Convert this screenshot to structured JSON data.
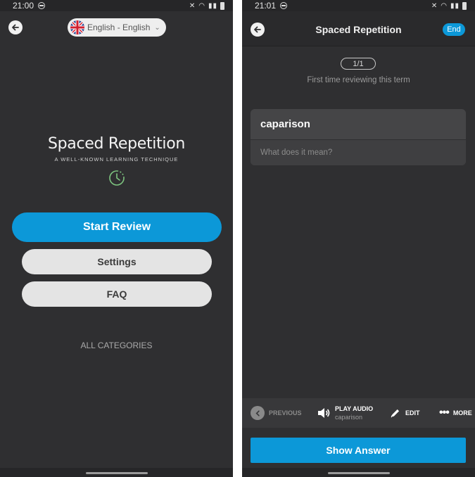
{
  "left_screen": {
    "status": {
      "time": "21:00"
    },
    "language_selector": {
      "label": "English - English"
    },
    "brand": {
      "title": "Spaced Repetition",
      "subtitle": "A WELL-KNOWN LEARNING TECHNIQUE"
    },
    "buttons": {
      "start_review": "Start Review",
      "settings": "Settings",
      "faq": "FAQ"
    },
    "all_categories": "ALL CATEGORIES"
  },
  "right_screen": {
    "status": {
      "time": "21:01"
    },
    "header": {
      "title": "Spaced Repetition",
      "end_label": "End"
    },
    "counter": "1/1",
    "review_note": "First time reviewing this term",
    "card": {
      "term": "caparison",
      "meaning_placeholder": "What does it mean?"
    },
    "toolbar": {
      "previous": "PREVIOUS",
      "play_audio": "PLAY AUDIO",
      "play_audio_sub": "caparison",
      "edit": "EDIT",
      "more": "MORE"
    },
    "show_answer": "Show Answer"
  },
  "colors": {
    "accent": "#0c98d8",
    "background": "#2f2f31",
    "card": "#454547"
  },
  "icons": [
    "back-arrow-icon",
    "uk-flag-icon",
    "chevron-down-icon",
    "clock-icon",
    "speaker-icon",
    "pencil-icon",
    "more-dots-icon",
    "previous-arrow-icon",
    "wifi-icon",
    "battery-icon",
    "mute-icon",
    "dnd-icon"
  ]
}
